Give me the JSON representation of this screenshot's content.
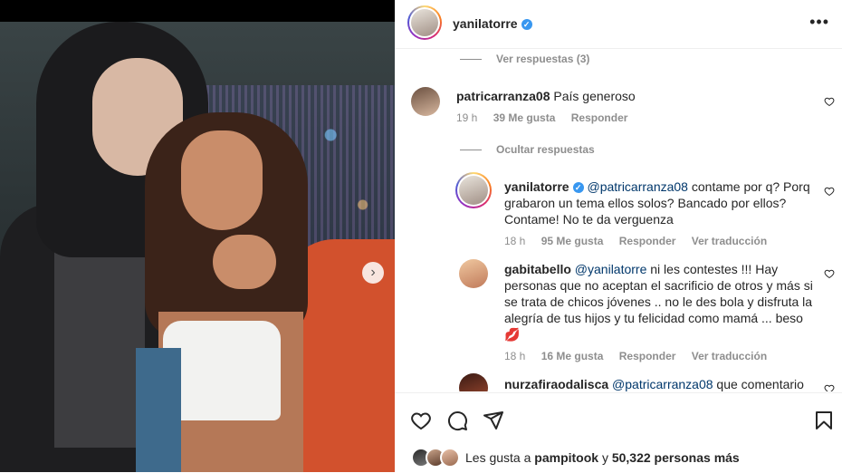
{
  "post": {
    "username": "yanilatorre",
    "more_label": "•••"
  },
  "comments": [
    {
      "kind": "view-replies",
      "text": "Ver respuestas (3)"
    },
    {
      "username": "patricarranza08",
      "text": "País generoso",
      "time": "19 h",
      "likes": "39 Me gusta",
      "reply": "Responder"
    },
    {
      "kind": "hide-replies",
      "text": "Ocultar respuestas"
    },
    {
      "username": "yanilatorre",
      "mention": "@patricarranza08",
      "text": " contame por q? Porq grabaron un tema ellos solos? Bancado por ellos? Contame! No te da verguenza",
      "time": "18 h",
      "likes": "95 Me gusta",
      "reply": "Responder",
      "translate": "Ver traducción"
    },
    {
      "username": "gabitabello",
      "mention": "@yanilatorre",
      "text": " ni les contestes !!! Hay personas que no aceptan el sacrificio de otros y más si se trata de chicos jóvenes .. no le des bola y disfruta la alegría de tus hijos y tu felicidad como mamá ... beso",
      "emoji": "💋",
      "time": "18 h",
      "likes": "16 Me gusta",
      "reply": "Responder",
      "translate": "Ver traducción"
    },
    {
      "username": "nurzafiraodalisca",
      "mention": "@patricarranza08",
      "text": " que comentario"
    }
  ],
  "likes": {
    "prefix": "Les gusta a ",
    "user": "pampitook",
    "middle": " y ",
    "count": "50,322 personas más"
  },
  "icons": [
    "heart-icon",
    "comment-icon",
    "share-icon",
    "bookmark-icon",
    "chevron-right-icon",
    "more-icon",
    "verified-icon"
  ]
}
